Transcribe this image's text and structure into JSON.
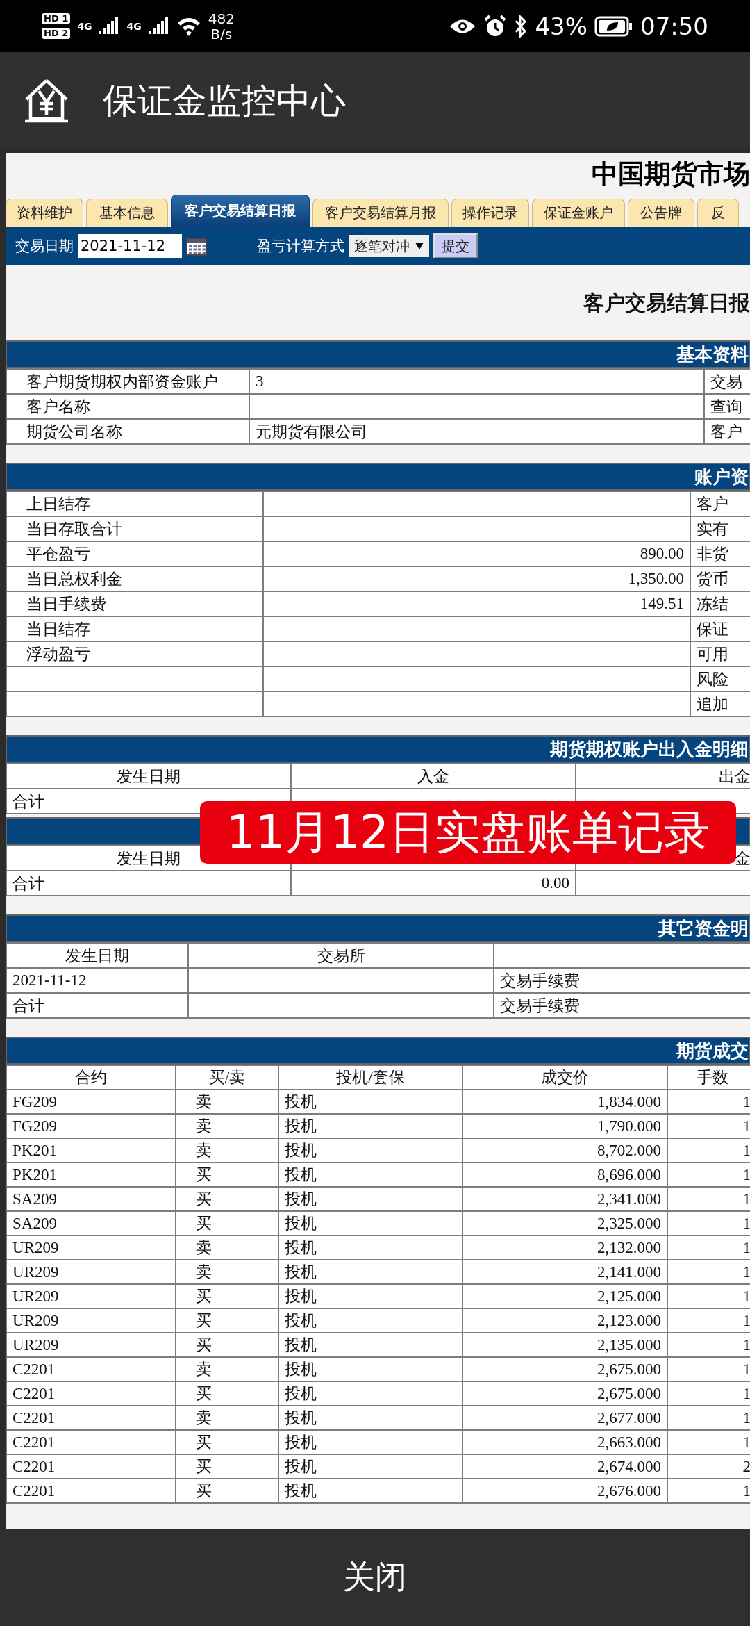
{
  "status_bar": {
    "sim_badges": [
      "HD 1",
      "HD 2"
    ],
    "networks": [
      "4G",
      "4G"
    ],
    "speed": [
      "482",
      "B/s"
    ],
    "battery": "43%",
    "time": "07:50"
  },
  "app_bar": {
    "title": "保证金监控中心"
  },
  "site_title": "中国期货市场",
  "tabs": [
    {
      "label": "资料维护",
      "selected": false
    },
    {
      "label": "基本信息",
      "selected": false
    },
    {
      "label": "客户交易结算日报",
      "selected": true
    },
    {
      "label": "客户交易结算月报",
      "selected": false
    },
    {
      "label": "操作记录",
      "selected": false
    },
    {
      "label": "保证金账户",
      "selected": false
    },
    {
      "label": "公告牌",
      "selected": false
    },
    {
      "label": "反",
      "selected": false
    }
  ],
  "filter": {
    "date_label": "交易日期",
    "date_value": "2021-11-12",
    "method_label": "盈亏计算方式",
    "method_value": "逐笔对冲",
    "submit": "提交"
  },
  "report_title": "客户交易结算日报",
  "sections": [
    {
      "kind": "info",
      "title": "基本资料",
      "rows": [
        [
          "客户期货期权内部资金账户",
          "3",
          "交易"
        ],
        [
          "客户名称",
          null,
          "查询"
        ],
        [
          "期货公司名称",
          "元期货有限公司",
          "客户"
        ]
      ]
    },
    {
      "kind": "account",
      "title": "账户资",
      "rows": [
        [
          "上日结存",
          null,
          "客户"
        ],
        [
          "当日存取合计",
          null,
          "实有"
        ],
        [
          "平仓盈亏",
          "890.00",
          "非货"
        ],
        [
          "当日总权利金",
          "1,350.00",
          "货币"
        ],
        [
          "当日手续费",
          "149.51",
          "冻结"
        ],
        [
          "当日结存",
          null,
          "保证"
        ],
        [
          "浮动盈亏",
          null,
          "可用"
        ],
        [
          null,
          null,
          "风险"
        ],
        [
          null,
          null,
          "追加"
        ]
      ]
    },
    {
      "kind": "money",
      "title": "期货期权账户出入金明细",
      "columns": [
        "发生日期",
        "入金",
        "出金"
      ],
      "rows": [
        [
          "合计",
          null,
          null
        ]
      ]
    },
    {
      "kind": "money",
      "columns": [
        "发生日期",
        null,
        "金"
      ],
      "rows": [
        [
          "合计",
          "0.00",
          null
        ]
      ]
    },
    {
      "kind": "other",
      "title": "其它资金明",
      "columns": [
        "发生日期",
        "交易所",
        null
      ],
      "rows": [
        [
          "2021-11-12",
          null,
          "交易手续费"
        ],
        [
          "合计",
          null,
          "交易手续费"
        ]
      ]
    },
    {
      "kind": "trades",
      "title": "期货成交",
      "columns": [
        "合约",
        "买/卖",
        "投机/套保",
        "成交价",
        "手数"
      ],
      "rows": [
        [
          "FG209",
          "卖",
          "投机",
          "1,834.000",
          "1"
        ],
        [
          "FG209",
          "卖",
          "投机",
          "1,790.000",
          "1"
        ],
        [
          "PK201",
          "卖",
          "投机",
          "8,702.000",
          "1"
        ],
        [
          "PK201",
          "买",
          "投机",
          "8,696.000",
          "1"
        ],
        [
          "SA209",
          "买",
          "投机",
          "2,341.000",
          "1"
        ],
        [
          "SA209",
          "买",
          "投机",
          "2,325.000",
          "1"
        ],
        [
          "UR209",
          "卖",
          "投机",
          "2,132.000",
          "1"
        ],
        [
          "UR209",
          "卖",
          "投机",
          "2,141.000",
          "1"
        ],
        [
          "UR209",
          "买",
          "投机",
          "2,125.000",
          "1"
        ],
        [
          "UR209",
          "买",
          "投机",
          "2,123.000",
          "1"
        ],
        [
          "UR209",
          "买",
          "投机",
          "2,135.000",
          "1"
        ],
        [
          "C2201",
          "卖",
          "投机",
          "2,675.000",
          "1"
        ],
        [
          "C2201",
          "买",
          "投机",
          "2,675.000",
          "1"
        ],
        [
          "C2201",
          "卖",
          "投机",
          "2,677.000",
          "1"
        ],
        [
          "C2201",
          "买",
          "投机",
          "2,663.000",
          "1"
        ],
        [
          "C2201",
          "买",
          "投机",
          "2,674.000",
          "2"
        ],
        [
          "C2201",
          "买",
          "投机",
          "2,676.000",
          "1"
        ]
      ]
    }
  ],
  "overlay_banner": {
    "text": "11月12日实盘账单记录"
  },
  "close_button": "关闭"
}
